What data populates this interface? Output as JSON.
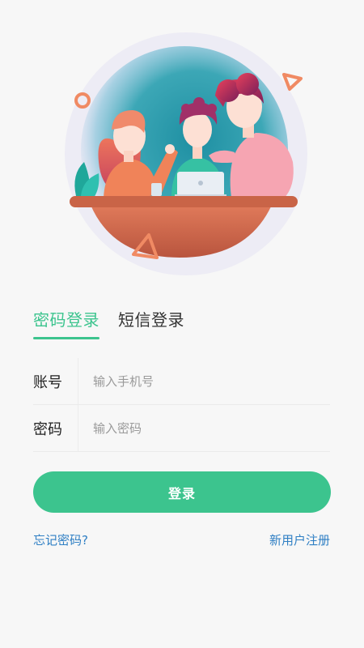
{
  "tabs": [
    {
      "label": "密码登录",
      "active": true
    },
    {
      "label": "短信登录",
      "active": false
    }
  ],
  "form": {
    "account_label": "账号",
    "account_placeholder": "输入手机号",
    "account_value": "",
    "password_label": "密码",
    "password_placeholder": "输入密码",
    "password_value": ""
  },
  "login_button": "登录",
  "links": {
    "forgot": "忘记密码?",
    "register": "新用户注册"
  },
  "colors": {
    "accent": "#3cc48e",
    "link": "#2f7fc4",
    "background": "#f7f7f7"
  },
  "illustration": "three-people-at-table-with-laptop"
}
